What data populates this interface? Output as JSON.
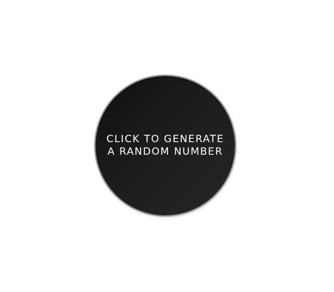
{
  "generator": {
    "line1": "CLICK TO GENERATE",
    "line2": "A RANDOM NUMBER"
  },
  "colors": {
    "background": "#ffffff",
    "circle_dark": "#0f0f0f",
    "circle_light": "#262626",
    "circle_border": "#9a9a9a",
    "text": "#ffffff"
  }
}
